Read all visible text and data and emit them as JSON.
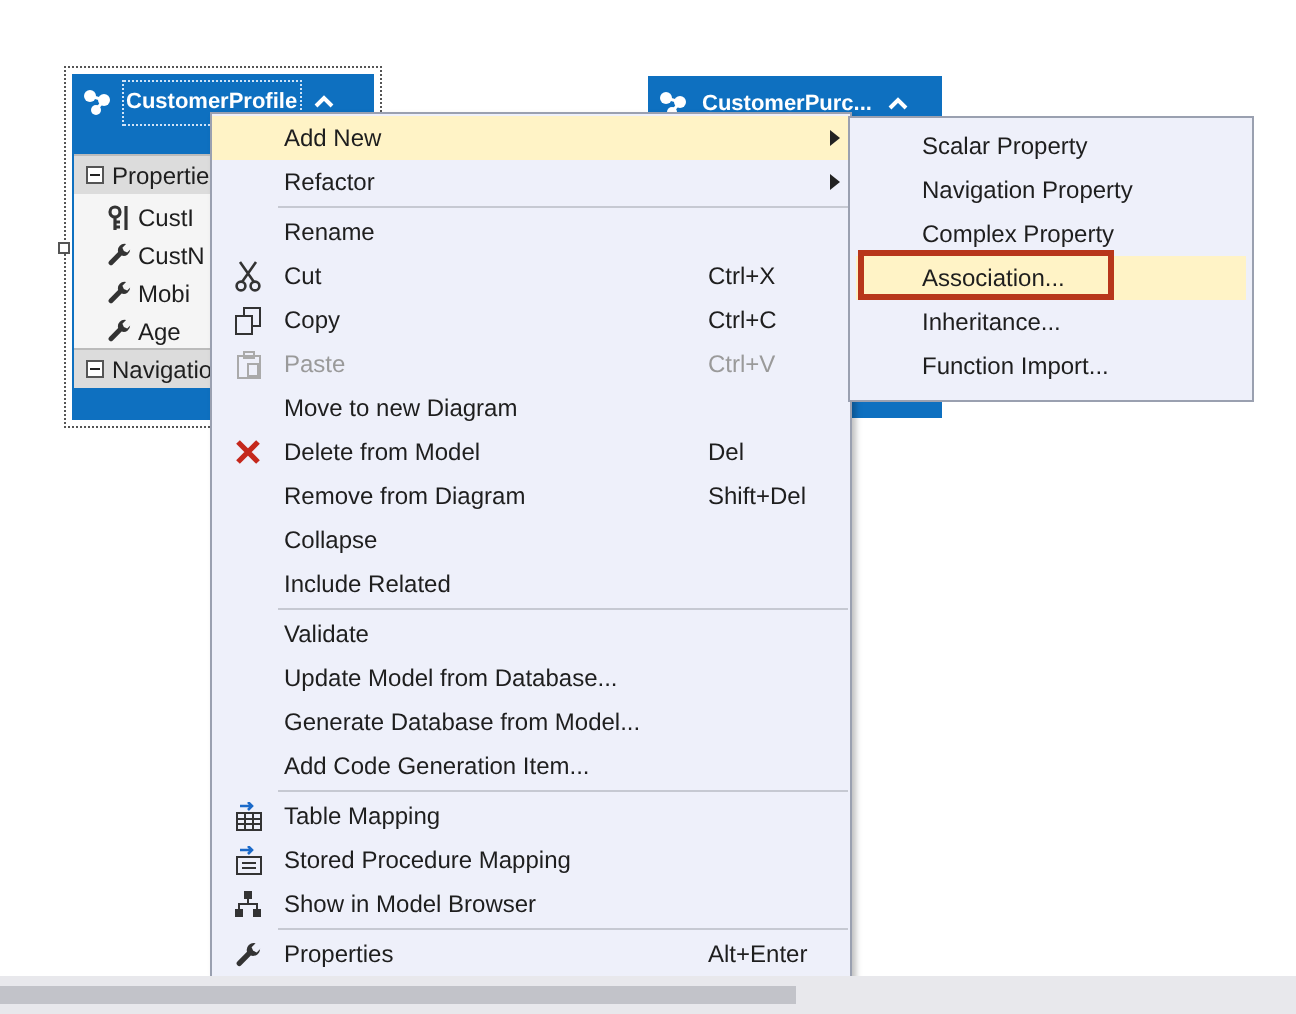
{
  "entities": [
    {
      "title": "CustomerProfile",
      "selected": true,
      "sections": [
        {
          "name": "Propertie",
          "expanded": true,
          "properties": [
            {
              "name": "CustI",
              "key": true
            },
            {
              "name": "CustN",
              "key": false
            },
            {
              "name": "Mobi",
              "key": false
            },
            {
              "name": "Age",
              "key": false
            }
          ]
        },
        {
          "name": "Navigatio",
          "expanded": true
        }
      ]
    },
    {
      "title": "CustomerPurc...",
      "selected": false
    }
  ],
  "context_menu": {
    "items": [
      {
        "kind": "item",
        "label": "Add New",
        "submenu": true,
        "selected": true,
        "disabled": false
      },
      {
        "kind": "item",
        "label": "Refactor",
        "submenu": true,
        "selected": false,
        "disabled": false
      },
      {
        "kind": "separator"
      },
      {
        "kind": "item",
        "label": "Rename",
        "submenu": false,
        "selected": false,
        "disabled": false
      },
      {
        "kind": "item",
        "label": "Cut",
        "shortcut": "Ctrl+X",
        "submenu": false,
        "selected": false,
        "disabled": false
      },
      {
        "kind": "item",
        "label": "Copy",
        "shortcut": "Ctrl+C",
        "submenu": false,
        "selected": false,
        "disabled": false
      },
      {
        "kind": "item",
        "label": "Paste",
        "shortcut": "Ctrl+V",
        "submenu": false,
        "selected": false,
        "disabled": true
      },
      {
        "kind": "item",
        "label": "Move to new Diagram",
        "submenu": false,
        "selected": false,
        "disabled": false
      },
      {
        "kind": "item",
        "label": "Delete from Model",
        "shortcut": "Del",
        "submenu": false,
        "selected": false,
        "disabled": false
      },
      {
        "kind": "item",
        "label": "Remove from Diagram",
        "shortcut": "Shift+Del",
        "submenu": false,
        "selected": false,
        "disabled": false
      },
      {
        "kind": "item",
        "label": "Collapse",
        "submenu": false,
        "selected": false,
        "disabled": false
      },
      {
        "kind": "item",
        "label": "Include Related",
        "submenu": false,
        "selected": false,
        "disabled": false
      },
      {
        "kind": "separator"
      },
      {
        "kind": "item",
        "label": "Validate",
        "submenu": false,
        "selected": false,
        "disabled": false
      },
      {
        "kind": "item",
        "label": "Update Model from Database...",
        "submenu": false,
        "selected": false,
        "disabled": false
      },
      {
        "kind": "item",
        "label": "Generate Database from Model...",
        "submenu": false,
        "selected": false,
        "disabled": false
      },
      {
        "kind": "item",
        "label": "Add Code Generation Item...",
        "submenu": false,
        "selected": false,
        "disabled": false
      },
      {
        "kind": "separator"
      },
      {
        "kind": "item",
        "label": "Table Mapping",
        "submenu": false,
        "selected": false,
        "disabled": false
      },
      {
        "kind": "item",
        "label": "Stored Procedure Mapping",
        "submenu": false,
        "selected": false,
        "disabled": false
      },
      {
        "kind": "item",
        "label": "Show in Model Browser",
        "submenu": false,
        "selected": false,
        "disabled": false
      },
      {
        "kind": "separator"
      },
      {
        "kind": "item",
        "label": "Properties",
        "shortcut": "Alt+Enter",
        "submenu": false,
        "selected": false,
        "disabled": false
      }
    ]
  },
  "submenu": {
    "items": [
      {
        "label": "Scalar Property",
        "selected": false,
        "outlined": false
      },
      {
        "label": "Navigation Property",
        "selected": false,
        "outlined": false
      },
      {
        "label": "Complex Property",
        "selected": false,
        "outlined": false
      },
      {
        "label": "Association...",
        "selected": true,
        "outlined": true
      },
      {
        "label": "Inheritance...",
        "selected": false,
        "outlined": false
      },
      {
        "label": "Function Import...",
        "selected": false,
        "outlined": false
      }
    ]
  }
}
